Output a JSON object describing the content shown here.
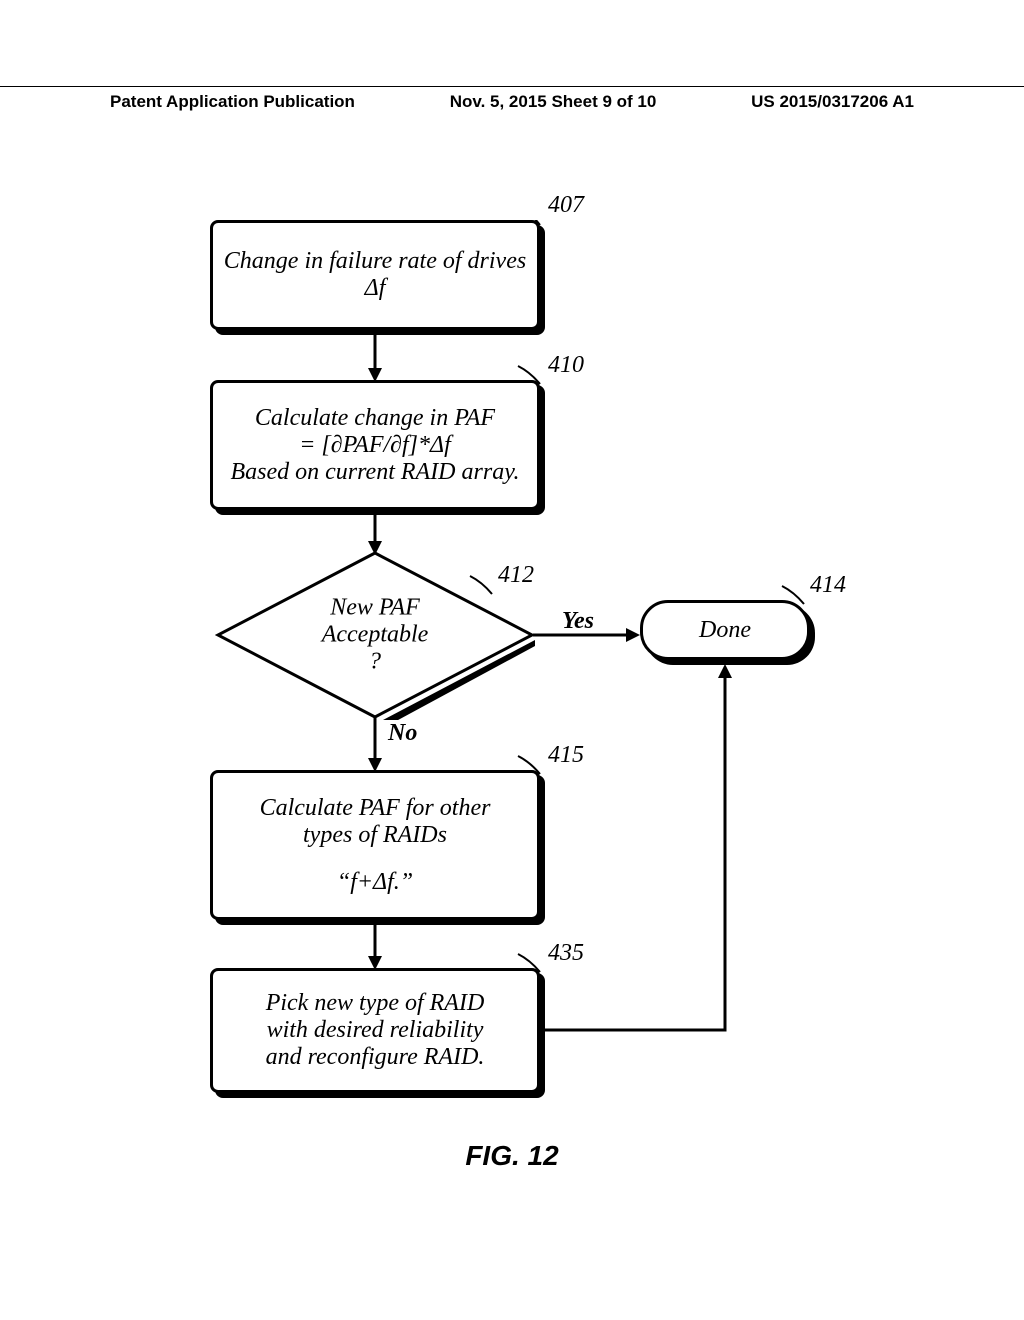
{
  "header": {
    "left": "Patent Application Publication",
    "center": "Nov. 5, 2015  Sheet 9 of 10",
    "right": "US 2015/0317206 A1"
  },
  "refs": {
    "r407": "407",
    "r410": "410",
    "r412": "412",
    "r414": "414",
    "r415": "415",
    "r435": "435"
  },
  "boxes": {
    "b407_l1": "Change in failure rate of drives",
    "b407_l2": "Δf",
    "b410_l1": "Calculate change in PAF",
    "b410_l2": "= [∂PAF/∂f]*Δf",
    "b410_l3": "Based on current RAID array.",
    "d412_l1": "New PAF",
    "d412_l2": "Acceptable",
    "d412_l3": "?",
    "b414": "Done",
    "b415_l1": "Calculate PAF for other",
    "b415_l2": "types of RAIDs",
    "b415_l3": "“f+Δf.”",
    "b435_l1": "Pick new type of RAID",
    "b435_l2": "with desired reliability",
    "b435_l3": "and reconfigure RAID."
  },
  "edges": {
    "yes": "Yes",
    "no": "No"
  },
  "figure_label": "FIG. 12"
}
